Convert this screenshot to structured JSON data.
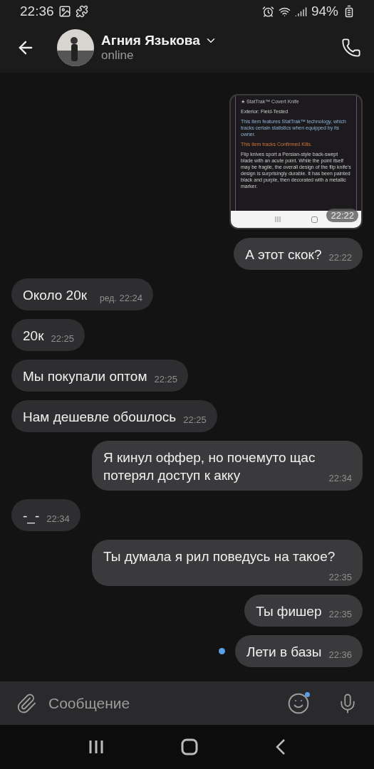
{
  "status_bar": {
    "time": "22:36",
    "battery": "94%"
  },
  "header": {
    "name": "Агния Язькова",
    "status": "online"
  },
  "messages": [
    {
      "kind": "image",
      "outgoing": true,
      "time": "22:22",
      "shot_lines": [
        {
          "kind": "title",
          "text": "★ StatTrak™ Covert Knife"
        },
        {
          "kind": "plain",
          "text": "Exterior: Field-Tested"
        },
        {
          "kind": "stattrak",
          "text": "This item features StatTrak™ technology, which tracks certain statistics when equipped by its owner."
        },
        {
          "kind": "kills",
          "text": "This item tracks Confirmed Kills."
        },
        {
          "kind": "plain",
          "text": "Flip knives sport a Persian-style back-swept blade with an acute point. While the point itself may be fragile, the overall design of the flip knife's design is surprisingly durable. It has been painted black and purple, then decorated with a metallic marker."
        }
      ]
    },
    {
      "kind": "text",
      "outgoing": true,
      "text": "А этот скок?",
      "time": "22:22"
    },
    {
      "kind": "text",
      "outgoing": false,
      "text": "Около 20к",
      "edited": "ред.",
      "time": "22:24"
    },
    {
      "kind": "text",
      "outgoing": false,
      "text": "20к",
      "time": "22:25"
    },
    {
      "kind": "text",
      "outgoing": false,
      "text": "Мы покупали оптом",
      "time": "22:25"
    },
    {
      "kind": "text",
      "outgoing": false,
      "text": "Нам дешевле обошлось",
      "time": "22:25"
    },
    {
      "kind": "text",
      "outgoing": true,
      "text": "Я кинул оффер, но почемуто щас потерял доступ к акку",
      "time": "22:34"
    },
    {
      "kind": "text",
      "outgoing": false,
      "text": "-_-",
      "time": "22:34"
    },
    {
      "kind": "text",
      "outgoing": true,
      "text": "Ты думала я рил поведусь на такое?",
      "time": "22:35"
    },
    {
      "kind": "text",
      "outgoing": true,
      "text": "Ты фишер",
      "time": "22:35"
    },
    {
      "kind": "text",
      "outgoing": true,
      "text": "Лети в базы",
      "time": "22:36",
      "unread": true
    }
  ],
  "composer": {
    "placeholder": "Сообщение"
  }
}
